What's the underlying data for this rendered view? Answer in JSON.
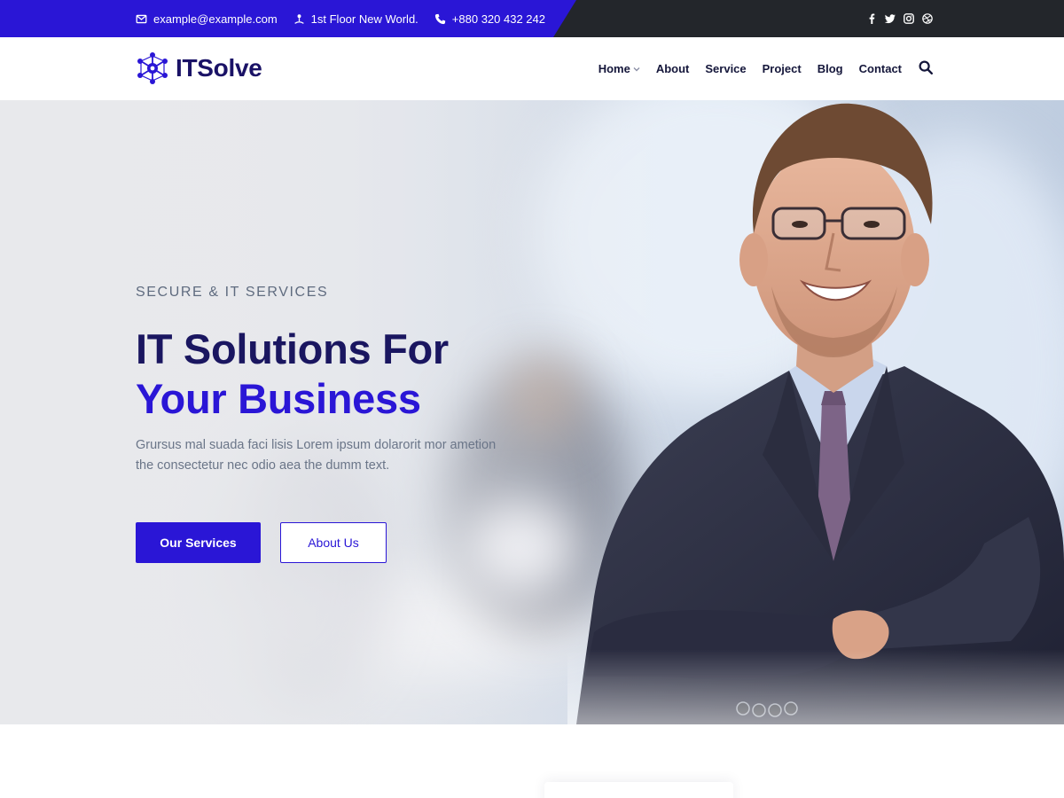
{
  "topbar": {
    "email": "example@example.com",
    "address": "1st Floor New World.",
    "phone": "+880 320 432 242",
    "socials": [
      "facebook-icon",
      "twitter-icon",
      "instagram-icon",
      "dribbble-icon"
    ]
  },
  "header": {
    "logo_text": "ITSolve",
    "nav": [
      "Home",
      "About",
      "Service",
      "Project",
      "Blog",
      "Contact"
    ]
  },
  "hero": {
    "subtitle": "SECURE & IT SERVICES",
    "title_line1": "IT Solutions For",
    "title_line2": "Your Business",
    "description": "Grursus mal suada faci lisis Lorem ipsum dolarorit mor ametion the consectetur nec odio aea the dumm text.",
    "primary_button": "Our Services",
    "secondary_button": "About Us"
  },
  "colors": {
    "brand": "#2a16d6",
    "dark": "#1a1660",
    "topbar_dark": "#23262b"
  }
}
